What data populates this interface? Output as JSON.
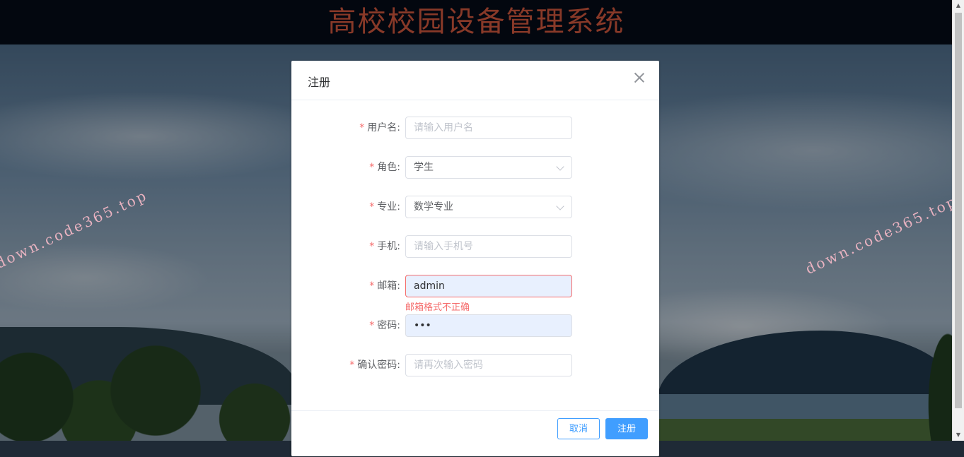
{
  "header": {
    "title": "高校校园设备管理系统"
  },
  "watermark": {
    "text": "down.code365.top"
  },
  "dialog": {
    "title": "注册",
    "fields": [
      {
        "label": "用户名:",
        "value": "",
        "placeholder": "请输入用户名",
        "type": "text",
        "required": true
      },
      {
        "label": "角色:",
        "value": "学生",
        "placeholder": "",
        "type": "select",
        "required": true
      },
      {
        "label": "专业:",
        "value": "数学专业",
        "placeholder": "",
        "type": "select",
        "required": true
      },
      {
        "label": "手机:",
        "value": "",
        "placeholder": "请输入手机号",
        "type": "text",
        "required": true
      },
      {
        "label": "邮箱:",
        "value": "admin",
        "placeholder": "",
        "type": "text",
        "required": true,
        "error": "邮箱格式不正确"
      },
      {
        "label": "密码:",
        "value": "•••",
        "placeholder": "",
        "type": "password",
        "required": true
      },
      {
        "label": "确认密码:",
        "value": "",
        "placeholder": "请再次输入密码",
        "type": "password",
        "required": true
      }
    ],
    "buttons": {
      "cancel": "取消",
      "submit": "注册"
    }
  },
  "colors": {
    "accent": "#409eff",
    "error": "#f56c6c",
    "title": "#c9553c"
  }
}
